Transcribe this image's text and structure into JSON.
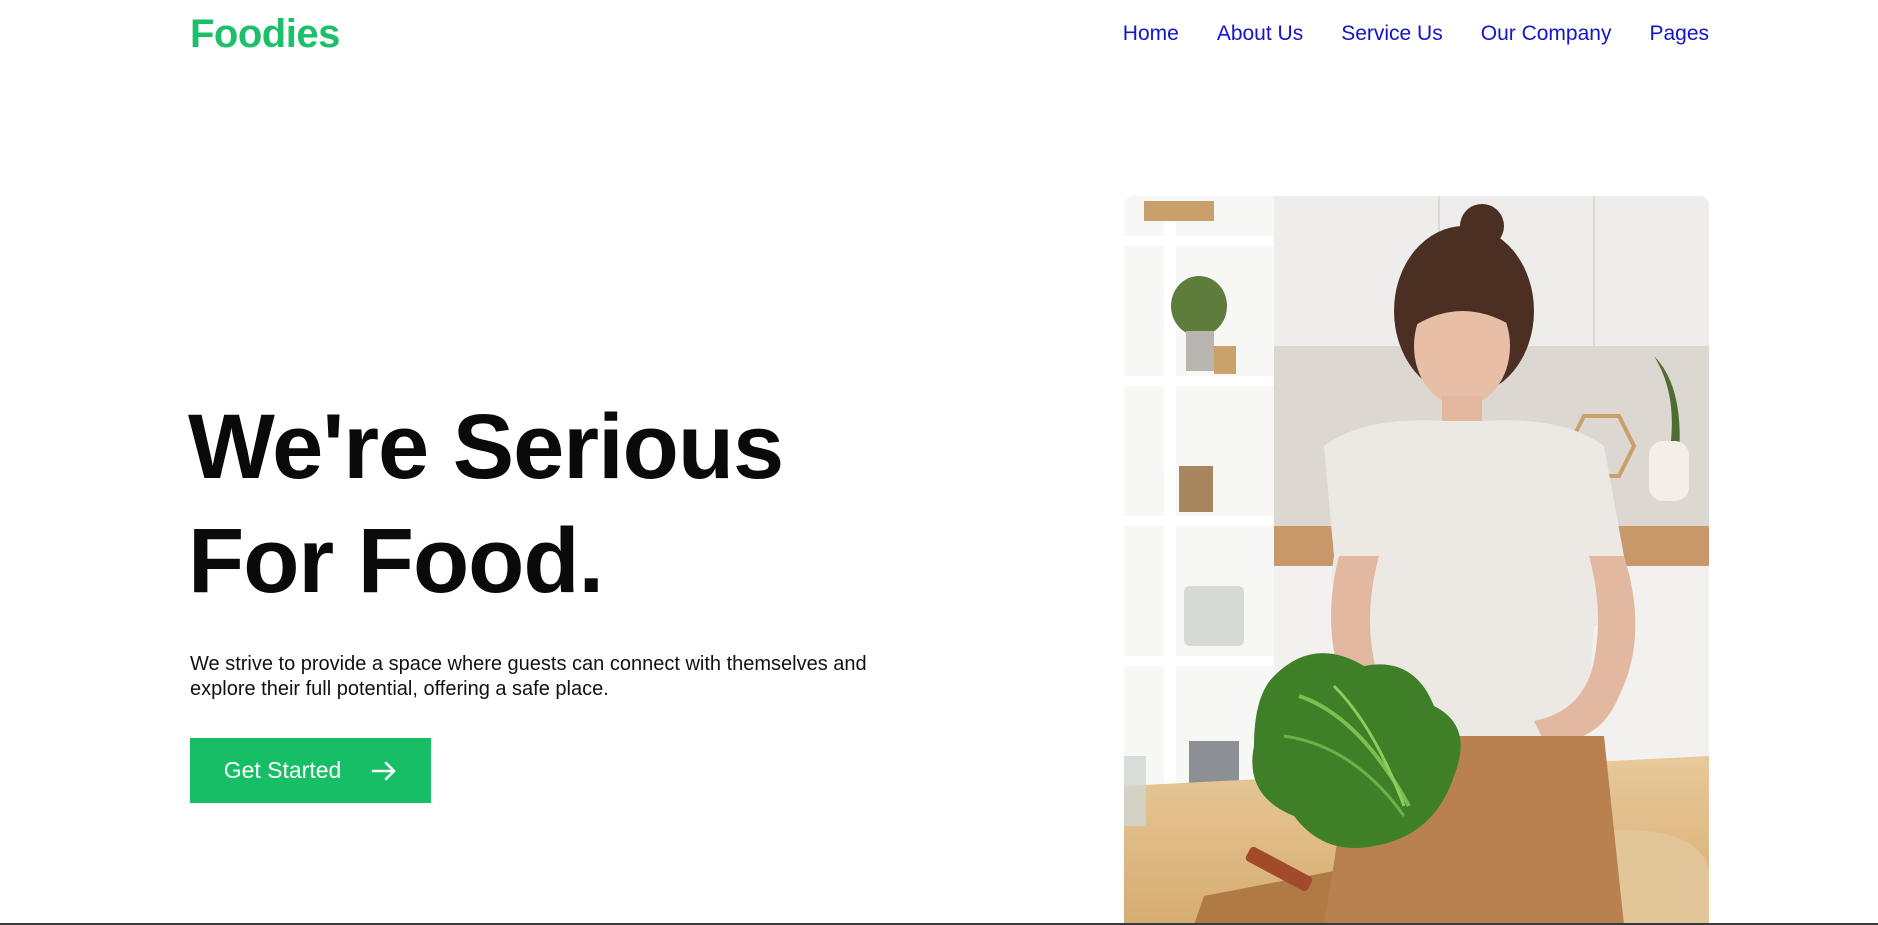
{
  "header": {
    "logo": "Foodies",
    "nav": [
      "Home",
      "About Us",
      "Service Us",
      "Our Company",
      "Pages"
    ]
  },
  "hero": {
    "title_line1": "We're Serious",
    "title_line2": "For Food.",
    "description": "We strive to provide a space where guests can connect with themselves and explore their full potential, offering a safe place.",
    "cta_label": "Get Started",
    "cta_icon": "arrow-right-icon",
    "image_icon": "woman-with-lettuce-photo"
  },
  "colors": {
    "brand_green": "#1cbf6a",
    "button_green": "#16bf66",
    "nav_link": "#1414c8"
  }
}
